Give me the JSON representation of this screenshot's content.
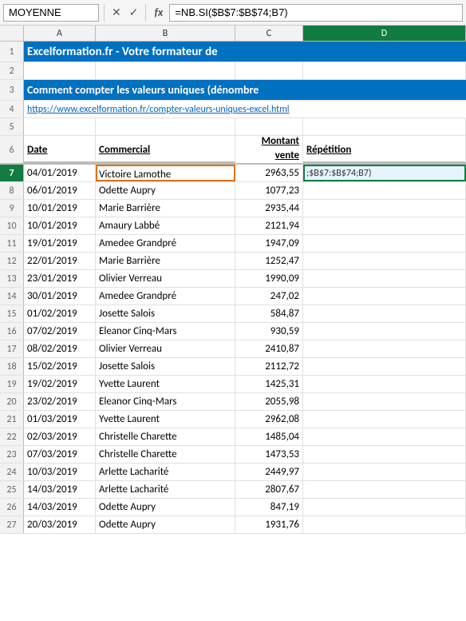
{
  "formulaBar": {
    "nameBox": "MOYENNE",
    "cancelBtn": "✕",
    "confirmBtn": "✓",
    "fxLabel": "fx",
    "formula": "=NB.SI($B$7:$B$74;B7)"
  },
  "columns": {
    "headers": [
      "A",
      "B",
      "C",
      "D"
    ],
    "widths": [
      90,
      175,
      85,
      204
    ]
  },
  "rows": [
    {
      "num": 1,
      "type": "title-blue",
      "cells": [
        "Excelformation.fr - Votre formateur de",
        "",
        "",
        ""
      ]
    },
    {
      "num": 2,
      "type": "empty",
      "cells": [
        "",
        "",
        "",
        ""
      ]
    },
    {
      "num": 3,
      "type": "subtitle-blue",
      "cells": [
        "Comment compter les valeurs uniques (dénombre",
        "",
        "",
        ""
      ]
    },
    {
      "num": 4,
      "type": "link",
      "cells": [
        "https://www.excelformation.fr/compter-valeurs-uniques-excel.html",
        "",
        "",
        ""
      ]
    },
    {
      "num": 5,
      "type": "empty",
      "cells": [
        "",
        "",
        "",
        ""
      ]
    },
    {
      "num": 6,
      "type": "header",
      "cells": [
        "Date",
        "Commercial",
        "Montant vente",
        "Répétition"
      ]
    },
    {
      "num": 7,
      "type": "data-selected",
      "cells": [
        "04/01/2019",
        "Victoire Lamothe",
        "2963,55",
        ";$B$7:$B$74;B7)"
      ]
    },
    {
      "num": 8,
      "type": "data",
      "cells": [
        "06/01/2019",
        "Odette Aupry",
        "1077,23",
        ""
      ]
    },
    {
      "num": 9,
      "type": "data",
      "cells": [
        "10/01/2019",
        "Marie Barrière",
        "2935,44",
        ""
      ]
    },
    {
      "num": 10,
      "type": "data",
      "cells": [
        "10/01/2019",
        "Amaury Labbé",
        "2121,94",
        ""
      ]
    },
    {
      "num": 11,
      "type": "data",
      "cells": [
        "19/01/2019",
        "Amedee Grandpré",
        "1947,09",
        ""
      ]
    },
    {
      "num": 12,
      "type": "data",
      "cells": [
        "22/01/2019",
        "Marie Barrière",
        "1252,47",
        ""
      ]
    },
    {
      "num": 13,
      "type": "data",
      "cells": [
        "23/01/2019",
        "Olivier Verreau",
        "1990,09",
        ""
      ]
    },
    {
      "num": 14,
      "type": "data",
      "cells": [
        "30/01/2019",
        "Amedee Grandpré",
        "247,02",
        ""
      ]
    },
    {
      "num": 15,
      "type": "data",
      "cells": [
        "01/02/2019",
        "Josette Salois",
        "584,87",
        ""
      ]
    },
    {
      "num": 16,
      "type": "data",
      "cells": [
        "07/02/2019",
        "Eleanor Cinq-Mars",
        "930,59",
        ""
      ]
    },
    {
      "num": 17,
      "type": "data",
      "cells": [
        "08/02/2019",
        "Olivier Verreau",
        "2410,87",
        ""
      ]
    },
    {
      "num": 18,
      "type": "data",
      "cells": [
        "15/02/2019",
        "Josette Salois",
        "2112,72",
        ""
      ]
    },
    {
      "num": 19,
      "type": "data",
      "cells": [
        "19/02/2019",
        "Yvette Laurent",
        "1425,31",
        ""
      ]
    },
    {
      "num": 20,
      "type": "data",
      "cells": [
        "23/02/2019",
        "Eleanor Cinq-Mars",
        "2055,98",
        ""
      ]
    },
    {
      "num": 21,
      "type": "data",
      "cells": [
        "01/03/2019",
        "Yvette Laurent",
        "2962,08",
        ""
      ]
    },
    {
      "num": 22,
      "type": "data",
      "cells": [
        "02/03/2019",
        "Christelle Charette",
        "1485,04",
        ""
      ]
    },
    {
      "num": 23,
      "type": "data",
      "cells": [
        "07/03/2019",
        "Christelle Charette",
        "1473,53",
        ""
      ]
    },
    {
      "num": 24,
      "type": "data",
      "cells": [
        "10/03/2019",
        "Arlette Lacharité",
        "2449,97",
        ""
      ]
    },
    {
      "num": 25,
      "type": "data",
      "cells": [
        "14/03/2019",
        "Arlette Lacharité",
        "2807,67",
        ""
      ]
    },
    {
      "num": 26,
      "type": "data",
      "cells": [
        "14/03/2019",
        "Odette Aupry",
        "847,19",
        ""
      ]
    },
    {
      "num": 27,
      "type": "data",
      "cells": [
        "20/03/2019",
        "Odette Aupry",
        "1931,76",
        ""
      ]
    }
  ],
  "colors": {
    "titleBlue": "#0070c0",
    "activeGreen": "#107c41",
    "linkBlue": "#0563c1",
    "selectedOutline": "#107c41",
    "columnHeaderActive": "#107c41"
  }
}
